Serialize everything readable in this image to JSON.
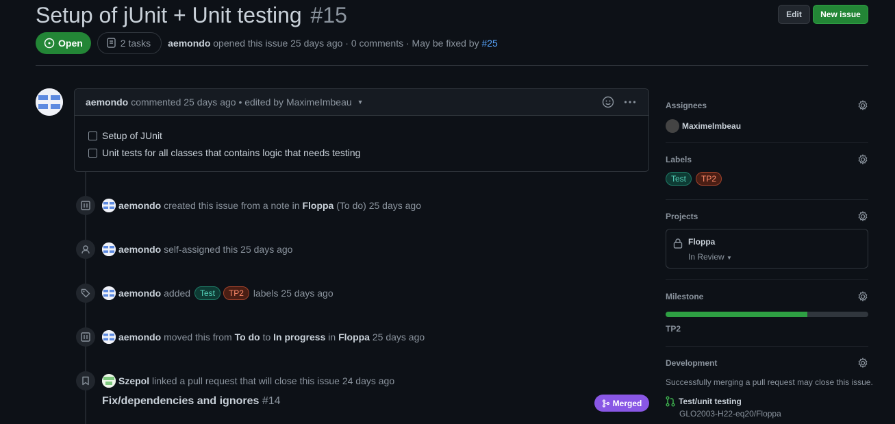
{
  "issue": {
    "title": "Setup of jUnit + Unit testing",
    "number": "#15",
    "state": "Open",
    "tasks": "2 tasks",
    "author": "aemondo",
    "meta_text": "opened this issue 25 days ago · 0 comments · May be fixed by",
    "fixed_by": "#25"
  },
  "header": {
    "edit_label": "Edit",
    "new_issue_label": "New issue"
  },
  "comment": {
    "author": "aemondo",
    "text": "commented 25 days ago • edited by MaximeImbeau",
    "tasks": [
      "Setup of JUnit",
      "Unit tests for all classes that contains logic that needs testing"
    ]
  },
  "timeline": {
    "e1": {
      "actor": "aemondo",
      "pre": "created this issue from a note in",
      "project": "Floppa",
      "column": "(To do)",
      "time": "25 days ago"
    },
    "e2": {
      "actor": "aemondo",
      "text": "self-assigned this 25 days ago"
    },
    "e3": {
      "actor": "aemondo",
      "pre": "added",
      "label1": "Test",
      "label2": "TP2",
      "post": "labels 25 days ago"
    },
    "e4": {
      "actor": "aemondo",
      "pre": "moved this from",
      "from": "To do",
      "mid": "to",
      "to": "In progress",
      "in": "in",
      "project": "Floppa",
      "time": "25 days ago"
    },
    "e5": {
      "actor": "Szepol",
      "text": "linked a pull request that will close this issue 24 days ago",
      "pr_title": "Fix/dependencies and ignores",
      "pr_number": "#14",
      "pr_state": "Merged"
    }
  },
  "sidebar": {
    "assignees": {
      "heading": "Assignees",
      "user": "MaximeImbeau"
    },
    "labels": {
      "heading": "Labels",
      "items": [
        "Test",
        "TP2"
      ]
    },
    "projects": {
      "heading": "Projects",
      "name": "Floppa",
      "status": "In Review"
    },
    "milestone": {
      "heading": "Milestone",
      "name": "TP2",
      "progress_percent": 70
    },
    "development": {
      "heading": "Development",
      "text": "Successfully merging a pull request may close this issue.",
      "pr": "Test/unit testing",
      "repo": "GLO2003-H22-eq20/Floppa"
    }
  },
  "colors": {
    "open": "#238636",
    "merged": "#8957e5",
    "label_test": "#56d4bb",
    "label_tp2": "#ff8b6b"
  }
}
